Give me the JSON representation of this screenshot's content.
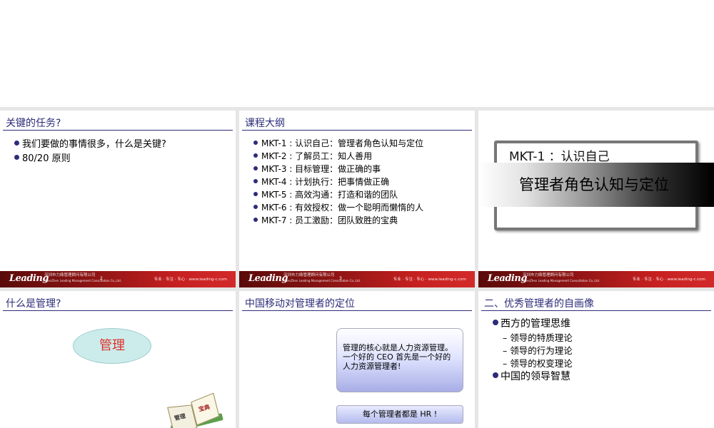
{
  "footer": {
    "logo": "Leading",
    "company_cn": "深圳市力鼎管理顾问有限公司",
    "company_en": "ShenZhen Leading Management Consultation Co.,Ltd.",
    "slogan": "专业 · 专注 · 专心 · www.leading-c.com"
  },
  "slides": [
    {
      "title": "关键的任务?",
      "page": "2",
      "bullets": [
        "我们要做的事情很多，什么是关键?",
        "80/20 原则"
      ]
    },
    {
      "title": "课程大纲",
      "page": "3",
      "outline": [
        "MKT-1 :  认识自己：管理者角色认知与定位",
        "MKT-2 :  了解员工：知人善用",
        "MKT-3 :  目标管理：做正确的事",
        "MKT-4 :  计划执行：把事情做正确",
        "MKT-5 :  高效沟通：打造和谐的团队",
        "MKT-6 :  有效授权：做一个聪明而懒惰的人",
        "MKT-7 :  员工激励：团队致胜的宝典"
      ]
    },
    {
      "kicker": "MKT-1 ：认识自己",
      "headline": "管理者角色认知与定位"
    },
    {
      "title": "什么是管理?",
      "ellipse": "管理",
      "book_left": "管理",
      "book_right": "宝典"
    },
    {
      "title": "中国移动对管理者的定位",
      "box_text": "管理的核心就是人力资源管理。一个好的 CEO 首先是一个好的人力资源管理者!",
      "box2_text": "每个管理者都是 HR !"
    },
    {
      "title": "二、优秀管理者的自画像",
      "item1": "西方的管理思维",
      "subitems": [
        "– 领导的特质理论",
        "– 领导的行为理论",
        "– 领导的权变理论"
      ],
      "item2": "中国的领导智慧"
    }
  ]
}
